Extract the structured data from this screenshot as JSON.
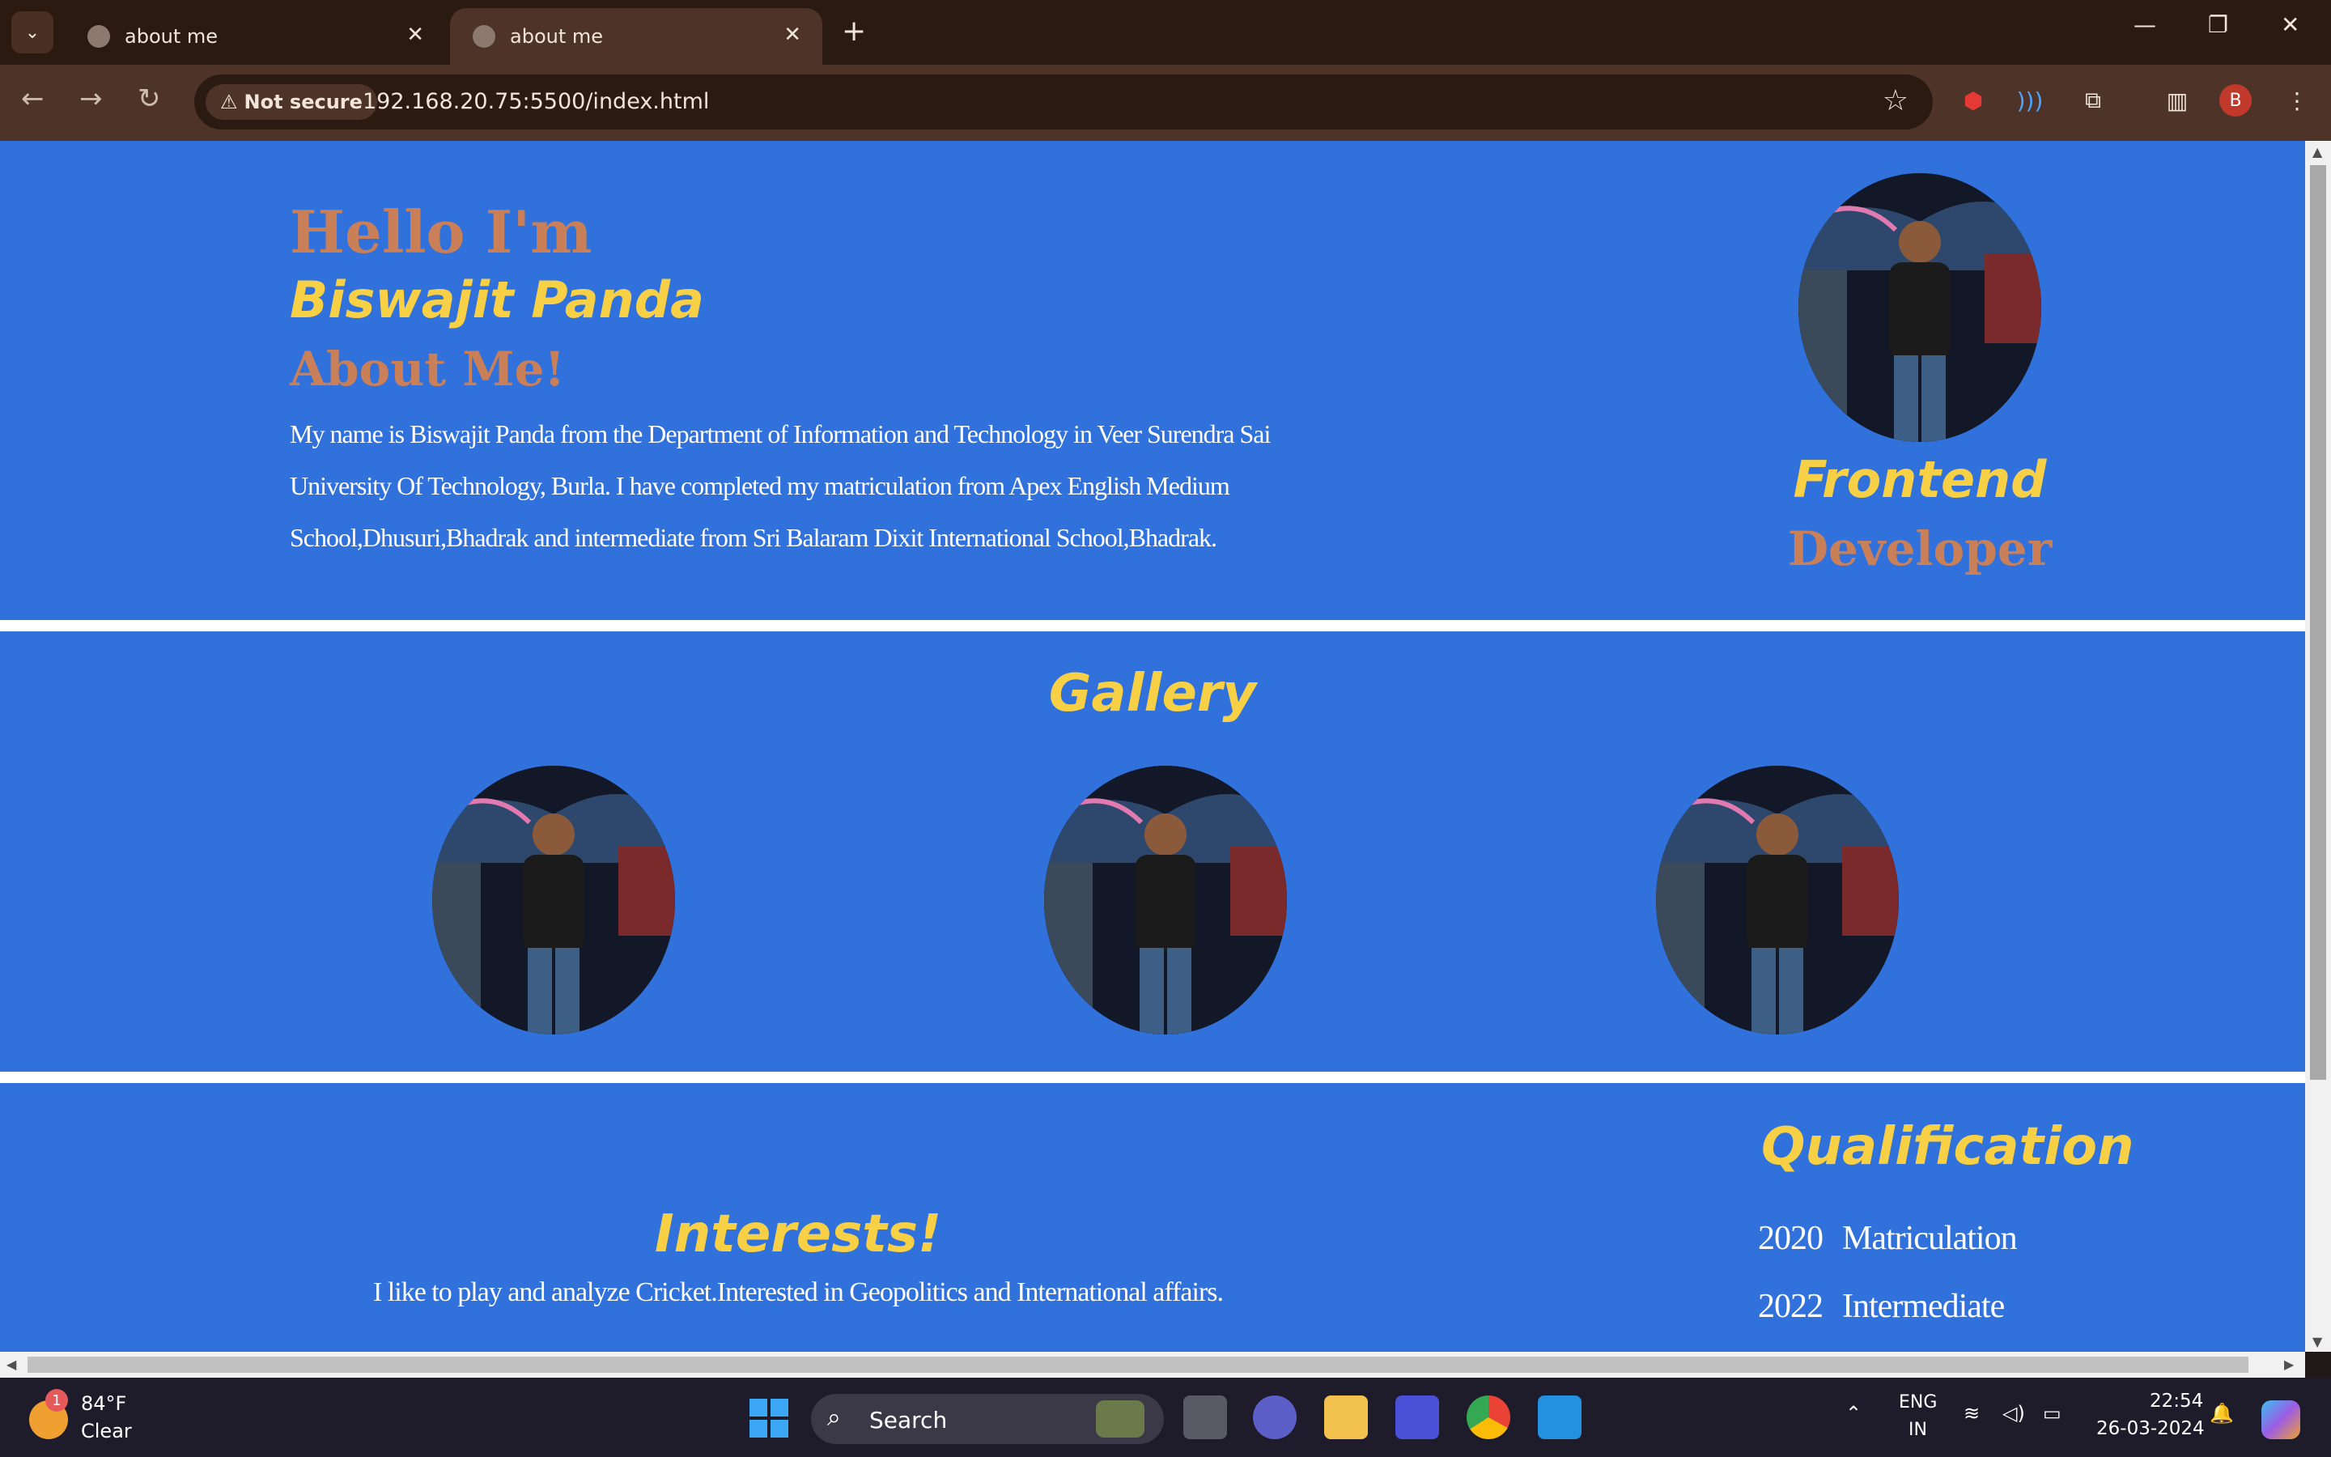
{
  "browser": {
    "tabs": [
      {
        "title": "about me",
        "active": false
      },
      {
        "title": "about me",
        "active": true
      }
    ],
    "security_label": "Not secure",
    "url": "192.168.20.75:5500/index.html",
    "profile_initial": "B"
  },
  "page": {
    "hero": {
      "greeting": "Hello I'm",
      "name": "Biswajit Panda",
      "about_heading": "About Me!",
      "about_text": "My name is Biswajit Panda from the Department of Information and Technology in Veer Surendra Sai University Of Technology, Burla. I have completed my matriculation from Apex English Medium School,Dhusuri,Bhadrak and intermediate from Sri Balaram Dixit International School,Bhadrak.",
      "role_line1": "Frontend",
      "role_line2": "Developer"
    },
    "gallery": {
      "heading": "Gallery",
      "photo_count": 3
    },
    "interests": {
      "heading": "Interests!",
      "text": "I like to play and analyze Cricket.Interested in Geopolitics and International affairs."
    },
    "qualification": {
      "heading": "Qualification",
      "items": [
        {
          "year": "2020",
          "title": "Matriculation"
        },
        {
          "year": "2022",
          "title": "Intermediate"
        }
      ]
    }
  },
  "taskbar": {
    "weather_temp": "84°F",
    "weather_cond": "Clear",
    "weather_badge": "1",
    "search_label": "Search",
    "lang_line1": "ENG",
    "lang_line2": "IN",
    "time": "22:54",
    "date": "26-03-2024"
  },
  "colors": {
    "section_bg": "#3171db",
    "accent_orange": "#c98058",
    "accent_yellow": "#f7d046"
  }
}
